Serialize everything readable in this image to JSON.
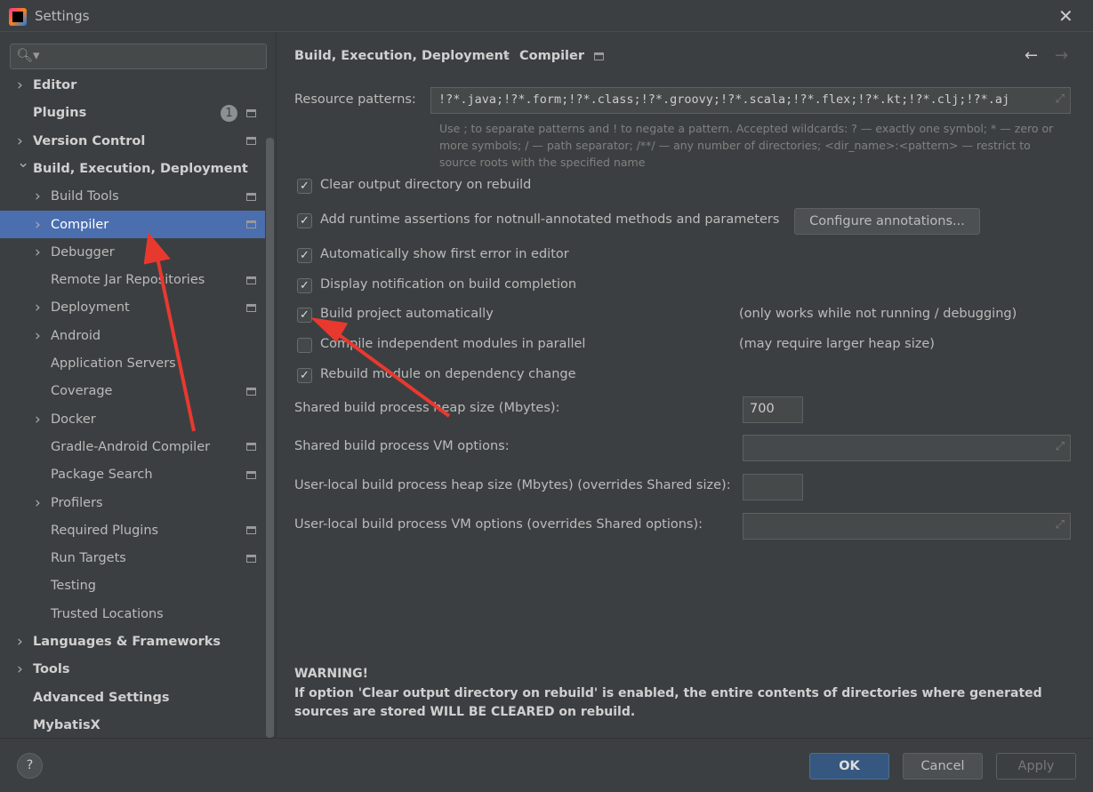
{
  "window": {
    "title": "Settings",
    "close_icon": "close-icon"
  },
  "sidebar": {
    "search_placeholder": "",
    "items": [
      {
        "label": "Editor",
        "level": 0,
        "chevron": "right",
        "bold": true
      },
      {
        "label": "Plugins",
        "level": 0,
        "bold": true,
        "badge": "1",
        "project_icon": true
      },
      {
        "label": "Version Control",
        "level": 0,
        "chevron": "right",
        "bold": true,
        "project_icon": true
      },
      {
        "label": "Build, Execution, Deployment",
        "level": 0,
        "chevron": "down",
        "bold": true
      },
      {
        "label": "Build Tools",
        "level": 1,
        "chevron": "right",
        "project_icon": true
      },
      {
        "label": "Compiler",
        "level": 1,
        "chevron": "right",
        "project_icon": true,
        "selected": true
      },
      {
        "label": "Debugger",
        "level": 1,
        "chevron": "right"
      },
      {
        "label": "Remote Jar Repositories",
        "level": 1,
        "project_icon": true
      },
      {
        "label": "Deployment",
        "level": 1,
        "chevron": "right",
        "project_icon": true
      },
      {
        "label": "Android",
        "level": 1,
        "chevron": "right"
      },
      {
        "label": "Application Servers",
        "level": 1
      },
      {
        "label": "Coverage",
        "level": 1,
        "project_icon": true
      },
      {
        "label": "Docker",
        "level": 1,
        "chevron": "right"
      },
      {
        "label": "Gradle-Android Compiler",
        "level": 1,
        "project_icon": true
      },
      {
        "label": "Package Search",
        "level": 1,
        "project_icon": true
      },
      {
        "label": "Profilers",
        "level": 1,
        "chevron": "right"
      },
      {
        "label": "Required Plugins",
        "level": 1,
        "project_icon": true
      },
      {
        "label": "Run Targets",
        "level": 1,
        "project_icon": true
      },
      {
        "label": "Testing",
        "level": 1
      },
      {
        "label": "Trusted Locations",
        "level": 1
      },
      {
        "label": "Languages & Frameworks",
        "level": 0,
        "chevron": "right",
        "bold": true
      },
      {
        "label": "Tools",
        "level": 0,
        "chevron": "right",
        "bold": true
      },
      {
        "label": "Advanced Settings",
        "level": 0,
        "bold": true
      },
      {
        "label": "MybatisX",
        "level": 0,
        "bold": true
      }
    ]
  },
  "main": {
    "breadcrumb": [
      "Build, Execution, Deployment",
      "Compiler"
    ],
    "resource_patterns": {
      "label": "Resource patterns:",
      "value": "!?*.java;!?*.form;!?*.class;!?*.groovy;!?*.scala;!?*.flex;!?*.kt;!?*.clj;!?*.aj",
      "help": "Use ; to separate patterns and ! to negate a pattern. Accepted wildcards: ? — exactly one symbol; * — zero or more symbols; / — path separator; /**/ — any number of directories; <dir_name>:<pattern> — restrict to source roots with the specified name"
    },
    "options": [
      {
        "label": "Clear output directory on rebuild",
        "checked": true,
        "note": ""
      },
      {
        "label": "Add runtime assertions for notnull-annotated methods and parameters",
        "checked": true,
        "note": ""
      },
      {
        "label": "Automatically show first error in editor",
        "checked": true,
        "note": ""
      },
      {
        "label": "Display notification on build completion",
        "checked": true,
        "note": ""
      },
      {
        "label": "Build project automatically",
        "checked": true,
        "note": "(only works while not running / debugging)"
      },
      {
        "label": "Compile independent modules in parallel",
        "checked": false,
        "note": "(may require larger heap size)"
      },
      {
        "label": "Rebuild module on dependency change",
        "checked": true,
        "note": ""
      }
    ],
    "configure_annotations": "Configure annotations...",
    "fields": [
      {
        "label": "Shared build process heap size (Mbytes):",
        "value": "700"
      },
      {
        "label": "Shared build process VM options:",
        "value": ""
      },
      {
        "label": "User-local build process heap size (Mbytes) (overrides Shared size):",
        "value": ""
      },
      {
        "label": "User-local build process VM options (overrides Shared options):",
        "value": ""
      }
    ],
    "warning_title": "WARNING!",
    "warning_text": "If option 'Clear output directory on rebuild' is enabled, the entire contents of directories where generated sources are stored WILL BE CLEARED on rebuild."
  },
  "footer": {
    "help": "?",
    "ok": "OK",
    "cancel": "Cancel",
    "apply": "Apply"
  },
  "colors": {
    "background": "#3c3f41",
    "selection": "#4b6eaf",
    "ok_button": "#365880",
    "annotation_arrow": "#e8392f"
  }
}
